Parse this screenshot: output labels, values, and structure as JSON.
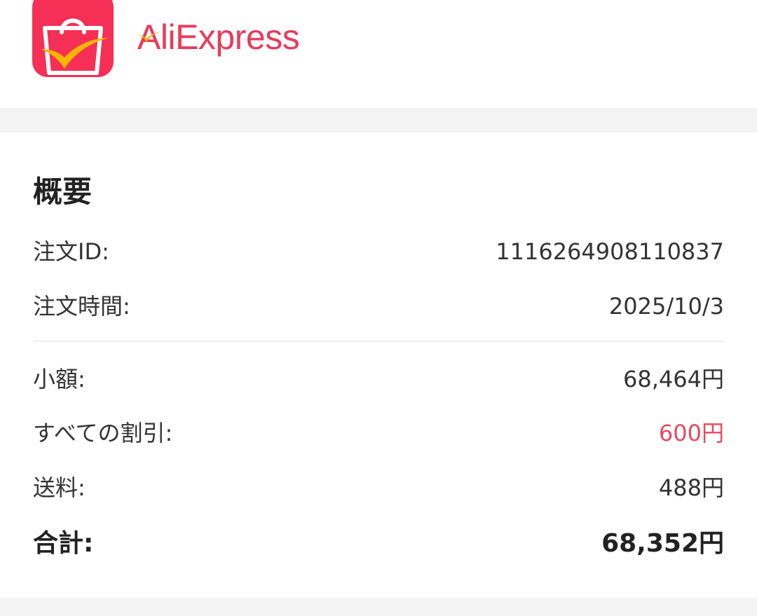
{
  "header": {
    "app_icon": "aliexpress-bag-icon",
    "brand_first": "A",
    "brand_rest": "liExpress",
    "colors": {
      "brand": "#ea3a5a",
      "icon_bg": "#f52f55",
      "check": "#f7b500"
    }
  },
  "summary": {
    "title": "概要",
    "order_id_label": "注文ID:",
    "order_id_value": "1116264908110837",
    "order_time_label": "注文時間:",
    "order_time_value": "2025/10/3",
    "subtotal_label": "小額:",
    "subtotal_value": "68,464円",
    "discount_label": "すべての割引:",
    "discount_value": "600円",
    "shipping_label": "送料:",
    "shipping_value": "488円",
    "total_label": "合計:",
    "total_value": "68,352円",
    "colors": {
      "discount": "#e8495f"
    }
  }
}
